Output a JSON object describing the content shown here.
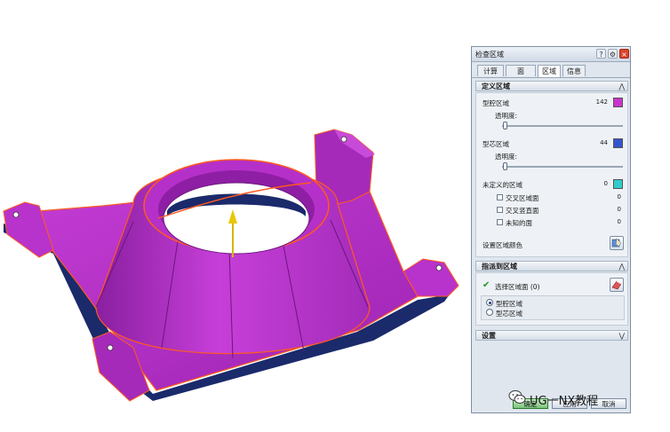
{
  "dialog": {
    "title": "检查区域",
    "tabs": [
      "计算",
      "面",
      "区域",
      "信息"
    ],
    "active_tab": "区域",
    "define_region": {
      "header": "定义区域",
      "cavity_region": {
        "label": "型腔区域",
        "count": "142",
        "color": "#cc33cc"
      },
      "cavity_transparency_label": "透明度:",
      "core_region": {
        "label": "型芯区域",
        "count": "44",
        "color": "#3355cc"
      },
      "core_transparency_label": "透明度:",
      "undefined_region": {
        "label": "未定义的区域",
        "count": "0",
        "color": "#33cccc"
      },
      "sub_items": [
        {
          "label": "交叉区域面",
          "count": "0"
        },
        {
          "label": "交叉竖直面",
          "count": "0"
        },
        {
          "label": "未知的面",
          "count": "0"
        }
      ],
      "set_color_label": "设置区域颜色"
    },
    "assign_region": {
      "header": "指派到区域",
      "select_faces_label": "选择区域面 (0)",
      "options": [
        "型腔区域",
        "型芯区域"
      ],
      "selected_option": "型腔区域"
    },
    "settings": {
      "header": "设置"
    },
    "footer": {
      "ok": "确定",
      "apply": "应用",
      "cancel": "取消"
    }
  },
  "watermark": "UG一NX教程",
  "icons": {
    "check": "check-icon",
    "close": "close-icon",
    "help": "help-icon",
    "settings": "gear-icon"
  }
}
